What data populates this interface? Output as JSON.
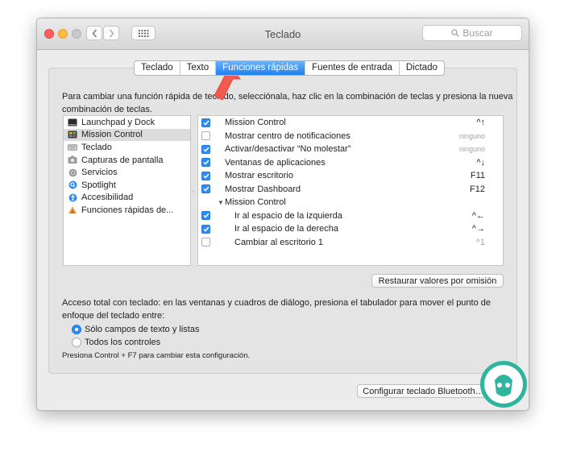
{
  "window": {
    "title": "Teclado",
    "search_placeholder": "Buscar"
  },
  "tabs": [
    {
      "label": "Teclado",
      "active": false
    },
    {
      "label": "Texto",
      "active": false
    },
    {
      "label": "Funciones rápidas",
      "active": true
    },
    {
      "label": "Fuentes de entrada",
      "active": false
    },
    {
      "label": "Dictado",
      "active": false
    }
  ],
  "description": "Para cambiar una función rápida de teclado, selecciónala, haz clic en la combinación de teclas y presiona la nueva combinación de teclas.",
  "categories": [
    {
      "label": "Launchpad y Dock",
      "icon": "launchpad-dock-icon",
      "selected": false
    },
    {
      "label": "Mission Control",
      "icon": "mission-control-icon",
      "selected": true
    },
    {
      "label": "Teclado",
      "icon": "keyboard-icon",
      "selected": false
    },
    {
      "label": "Capturas de pantalla",
      "icon": "screenshot-icon",
      "selected": false
    },
    {
      "label": "Servicios",
      "icon": "gear-icon",
      "selected": false
    },
    {
      "label": "Spotlight",
      "icon": "spotlight-icon",
      "selected": false
    },
    {
      "label": "Accesibilidad",
      "icon": "accessibility-icon",
      "selected": false
    },
    {
      "label": "Funciones rápidas de...",
      "icon": "app-shortcuts-icon",
      "selected": false
    }
  ],
  "shortcuts": [
    {
      "label": "Mission Control",
      "shortcut": "^↑",
      "checked": true,
      "indent": 0
    },
    {
      "label": "Mostrar centro de notificaciones",
      "shortcut": "ninguno",
      "checked": false,
      "indent": 0
    },
    {
      "label": "Activar/desactivar “No molestar”",
      "shortcut": "ninguno",
      "checked": true,
      "indent": 0
    },
    {
      "label": "Ventanas de aplicaciones",
      "shortcut": "^↓",
      "checked": true,
      "indent": 0
    },
    {
      "label": "Mostrar escritorio",
      "shortcut": "F11",
      "checked": true,
      "indent": 0
    },
    {
      "label": "Mostrar Dashboard",
      "shortcut": "F12",
      "checked": true,
      "indent": 0
    },
    {
      "label": "Mission Control",
      "shortcut": "",
      "checked": null,
      "indent": 0,
      "group": true
    },
    {
      "label": "Ir al espacio de la izquierda",
      "shortcut": "^←",
      "checked": true,
      "indent": 1
    },
    {
      "label": "Ir al espacio de la derecha",
      "shortcut": "^→",
      "checked": true,
      "indent": 1
    },
    {
      "label": "Cambiar al escritorio 1",
      "shortcut": "^1",
      "checked": false,
      "indent": 1
    }
  ],
  "restore_button": "Restaurar valores por omisión",
  "full_access_text": "Acceso total con teclado: en las ventanas y cuadros de diálogo, presiona el tabulador para mover el punto de enfoque del teclado entre:",
  "radio_options": [
    {
      "label": "Sólo campos de texto y listas",
      "selected": true
    },
    {
      "label": "Todos los controles",
      "selected": false
    }
  ],
  "note": "Presiona Control + F7 para cambiar esta configuración.",
  "bluetooth_button": "Configurar teclado Bluetooth…",
  "colors": {
    "accent": "#2d8cf5",
    "arrow": "#f05a50",
    "logo": "#2fb4a0"
  }
}
